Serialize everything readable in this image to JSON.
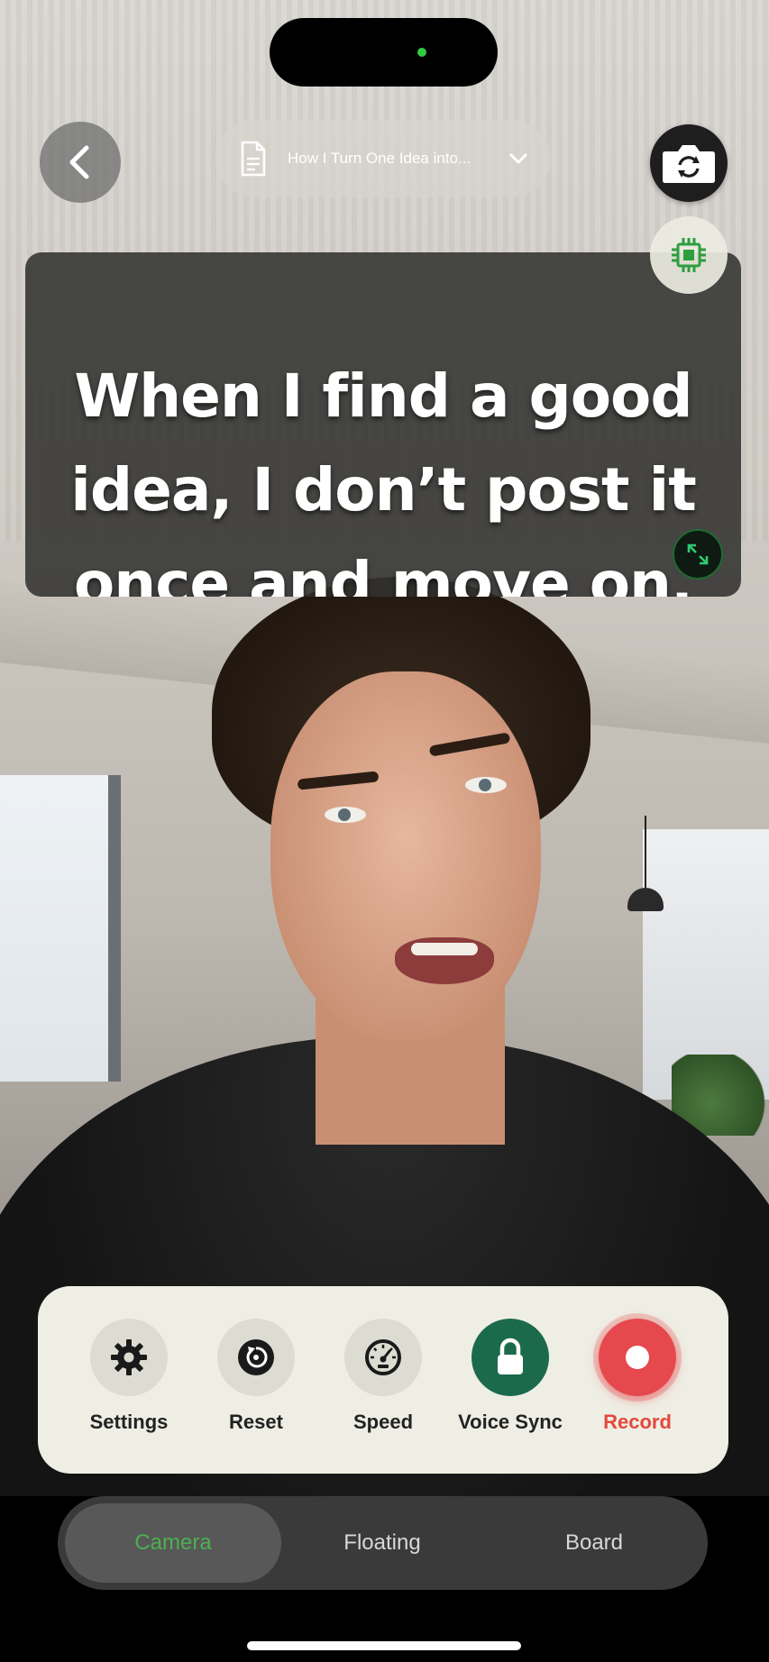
{
  "top_bar": {
    "back_icon": "chevron-left-icon",
    "script_title": "How I Turn One Idea into...",
    "document_icon": "document-icon",
    "dropdown_icon": "chevron-down-icon",
    "flip_camera_icon": "camera-flip-icon",
    "processor_icon": "chip-icon"
  },
  "teleprompter": {
    "line1": "When I find a good",
    "line2": "idea, I don’t post it",
    "line3": "once and move on.",
    "expand_icon": "expand-icon"
  },
  "controls": [
    {
      "label": "Settings",
      "icon": "gear-icon"
    },
    {
      "label": "Reset",
      "icon": "reset-icon"
    },
    {
      "label": "Speed",
      "icon": "speedometer-icon"
    },
    {
      "label": "Voice Sync",
      "icon": "lock-icon"
    },
    {
      "label": "Record",
      "icon": "record-icon"
    }
  ],
  "modes": {
    "selected": "Camera",
    "items": [
      {
        "label": "Camera"
      },
      {
        "label": "Floating"
      },
      {
        "label": "Board"
      }
    ]
  },
  "colors": {
    "accent_green": "#4caf50",
    "record_red": "#e5484d",
    "voice_sync_green": "#1c6a4c",
    "panel_bg": "#efeee4"
  }
}
